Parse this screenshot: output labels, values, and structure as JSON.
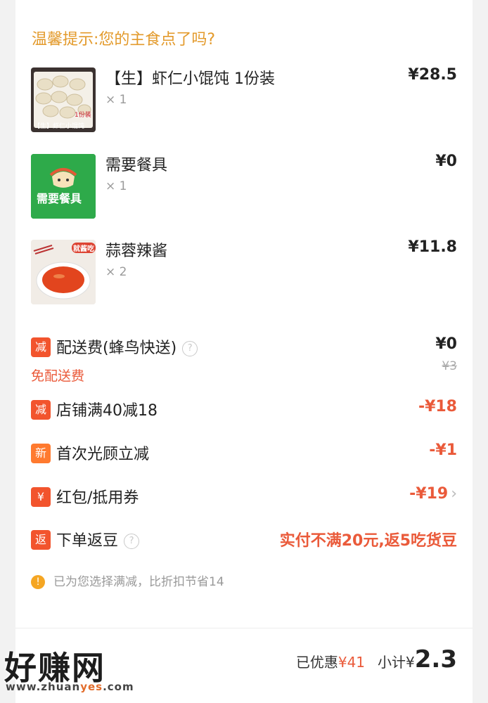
{
  "header": {
    "tip": "温馨提示:您的主食点了吗?"
  },
  "items": [
    {
      "name": "【生】虾仁小馄饨 1份装",
      "qty": "× 1",
      "price": "¥28.5",
      "thumb_text": "【生】虾仁小馄饨",
      "thumb_tag": "1份装"
    },
    {
      "name": "需要餐具",
      "qty": "× 1",
      "price": "¥0",
      "thumb_text": "需要餐具"
    },
    {
      "name": "蒜蓉辣酱",
      "qty": "× 2",
      "price": "¥11.8",
      "thumb_text": "就酱吃"
    }
  ],
  "fees": {
    "delivery": {
      "badge": "减",
      "label": "配送费(蜂鸟快送)",
      "help": "?",
      "value": "¥0",
      "original": "¥3",
      "note": "免配送费"
    },
    "store_discount": {
      "badge": "减",
      "label": "店铺满40减18",
      "value": "-¥18"
    },
    "first_visit": {
      "badge": "新",
      "label": "首次光顾立减",
      "value": "-¥1"
    },
    "coupon": {
      "badge": "¥",
      "label": "红包/抵用券",
      "value": "-¥19",
      "chevron": "›"
    },
    "beans": {
      "badge": "返",
      "label": "下单返豆",
      "help": "?",
      "value": "实付不满20元,返5吃货豆"
    }
  },
  "info": {
    "icon": "!",
    "text": "已为您选择满减，比折扣节省14"
  },
  "footer": {
    "saved_label": "已优惠",
    "saved_value": "¥41",
    "subtotal_label": "小计",
    "subtotal_currency": "¥",
    "subtotal_value": "2.3"
  },
  "watermark": {
    "logo": "好赚网",
    "url_pre": "www.zhuan",
    "url_hl": "yes",
    "url_post": ".com"
  },
  "colors": {
    "accent_red": "#ea5a3a",
    "tip_orange": "#e39a2b",
    "badge_red": "#f2542d",
    "badge_orange": "#ff7a2f",
    "green": "#2eaa4a"
  },
  "icons": {
    "help": "help-circle-icon",
    "info": "info-circle-icon",
    "chevron": "chevron-right-icon"
  }
}
